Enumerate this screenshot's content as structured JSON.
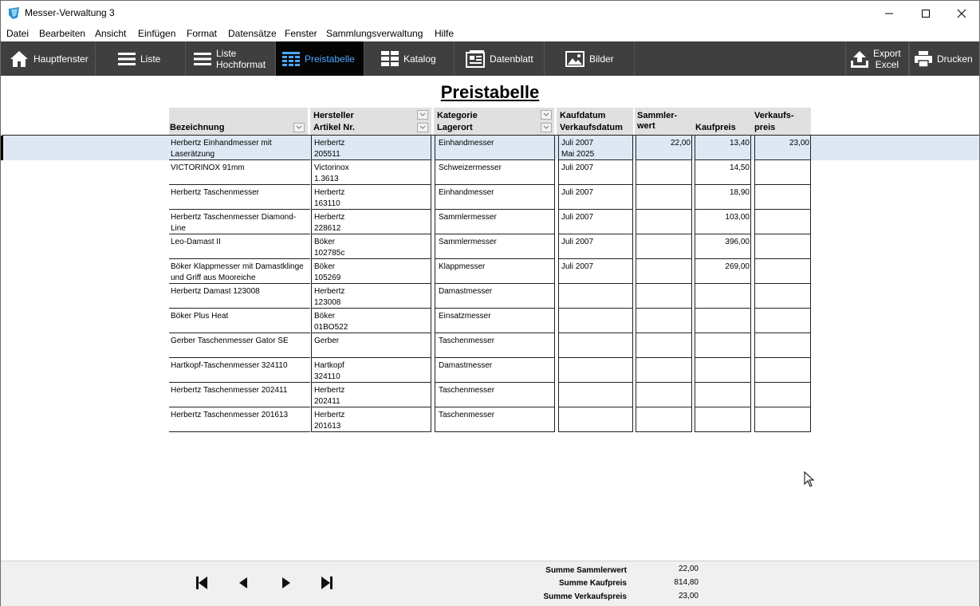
{
  "window": {
    "title": "Messer-Verwaltung 3"
  },
  "menu": [
    "Datei",
    "Bearbeiten",
    "Ansicht",
    "Einfügen",
    "Format",
    "Datensätze",
    "Fenster",
    "Sammlungsverwaltung",
    "Hilfe"
  ],
  "toolbar": {
    "hauptfenster": "Hauptfenster",
    "liste": "Liste",
    "liste_hochformat_1": "Liste",
    "liste_hochformat_2": "Hochformat",
    "preistabelle": "Preistabelle",
    "katalog": "Katalog",
    "datenblatt": "Datenblatt",
    "bilder": "Bilder",
    "export_1": "Export",
    "export_2": "Excel",
    "drucken": "Drucken"
  },
  "page": {
    "title": "Preistabelle"
  },
  "columns": {
    "bezeichnung": "Bezeichnung",
    "hersteller": "Hersteller",
    "artikel": "Artikel Nr.",
    "kategorie": "Kategorie",
    "lagerort": "Lagerort",
    "kaufdatum": "Kaufdatum",
    "verkaufsdatum": "Verkaufsdatum",
    "sammlerwert_1": "Sammler-",
    "sammlerwert_2": "wert",
    "kaufpreis": "Kaufpreis",
    "verkaufspreis_1": "Verkaufs-",
    "verkaufspreis_2": "preis"
  },
  "rows": [
    {
      "bez1": "Herbertz Einhandmesser mit",
      "bez2": "Laserätzung",
      "hersteller": "Herbertz",
      "artikel": "205511",
      "kategorie": "Einhandmesser",
      "lagerort": "",
      "kaufdatum": "Juli 2007",
      "verkaufsdatum": "Mai 2025",
      "sammlerwert": "22,00",
      "kaufpreis": "13,40",
      "verkaufspreis": "23,00",
      "selected": true
    },
    {
      "bez1": "VICTORINOX 91mm",
      "bez2": "",
      "hersteller": "Victorinox",
      "artikel": "1.3613",
      "kategorie": "Schweizermesser",
      "lagerort": "",
      "kaufdatum": "Juli 2007",
      "verkaufsdatum": "",
      "sammlerwert": "",
      "kaufpreis": "14,50",
      "verkaufspreis": ""
    },
    {
      "bez1": "Herbertz Taschenmesser",
      "bez2": "",
      "hersteller": "Herbertz",
      "artikel": "163110",
      "kategorie": "Einhandmesser",
      "lagerort": "",
      "kaufdatum": "Juli 2007",
      "verkaufsdatum": "",
      "sammlerwert": "",
      "kaufpreis": "18,90",
      "verkaufspreis": ""
    },
    {
      "bez1": "Herbertz Taschenmesser Diamond-",
      "bez2": "Line",
      "hersteller": "Herbertz",
      "artikel": "228612",
      "kategorie": "Sammlermesser",
      "lagerort": "",
      "kaufdatum": "Juli 2007",
      "verkaufsdatum": "",
      "sammlerwert": "",
      "kaufpreis": "103,00",
      "verkaufspreis": ""
    },
    {
      "bez1": "Leo-Damast II",
      "bez2": "",
      "hersteller": "Böker",
      "artikel": "102785c",
      "kategorie": "Sammlermesser",
      "lagerort": "",
      "kaufdatum": "Juli 2007",
      "verkaufsdatum": "",
      "sammlerwert": "",
      "kaufpreis": "396,00",
      "verkaufspreis": ""
    },
    {
      "bez1": "Böker Klappmesser mit Damastklinge",
      "bez2": "und Griff aus Mooreiche",
      "hersteller": "Böker",
      "artikel": "105269",
      "kategorie": "Klappmesser",
      "lagerort": "",
      "kaufdatum": "Juli 2007",
      "verkaufsdatum": "",
      "sammlerwert": "",
      "kaufpreis": "269,00",
      "verkaufspreis": ""
    },
    {
      "bez1": "Herbertz Damast  123008",
      "bez2": "",
      "hersteller": "Herbertz",
      "artikel": "123008",
      "kategorie": "Damastmesser",
      "lagerort": "",
      "kaufdatum": "",
      "verkaufsdatum": "",
      "sammlerwert": "",
      "kaufpreis": "",
      "verkaufspreis": ""
    },
    {
      "bez1": "Böker Plus Heat",
      "bez2": "",
      "hersteller": "Böker",
      "artikel": "01BO522",
      "kategorie": "Einsatzmesser",
      "lagerort": "",
      "kaufdatum": "",
      "verkaufsdatum": "",
      "sammlerwert": "",
      "kaufpreis": "",
      "verkaufspreis": ""
    },
    {
      "bez1": "Gerber Taschenmesser Gator SE",
      "bez2": "",
      "hersteller": "Gerber",
      "artikel": "",
      "kategorie": "Taschenmesser",
      "lagerort": "",
      "kaufdatum": "",
      "verkaufsdatum": "",
      "sammlerwert": "",
      "kaufpreis": "",
      "verkaufspreis": ""
    },
    {
      "bez1": "Hartkopf-Taschenmesser 324110",
      "bez2": "",
      "hersteller": "Hartkopf",
      "artikel": "324110",
      "kategorie": "Damastmesser",
      "lagerort": "",
      "kaufdatum": "",
      "verkaufsdatum": "",
      "sammlerwert": "",
      "kaufpreis": "",
      "verkaufspreis": ""
    },
    {
      "bez1": "Herbertz Taschenmesser 202411",
      "bez2": "",
      "hersteller": "Herbertz",
      "artikel": "202411",
      "kategorie": "Taschenmesser",
      "lagerort": "",
      "kaufdatum": "",
      "verkaufsdatum": "",
      "sammlerwert": "",
      "kaufpreis": "",
      "verkaufspreis": ""
    },
    {
      "bez1": "Herbertz Taschenmesser 201613",
      "bez2": "",
      "hersteller": "Herbertz",
      "artikel": "201613",
      "kategorie": "Taschenmesser",
      "lagerort": "",
      "kaufdatum": "",
      "verkaufsdatum": "",
      "sammlerwert": "",
      "kaufpreis": "",
      "verkaufspreis": ""
    }
  ],
  "summary": {
    "sammlerwert_label": "Summe Sammlerwert",
    "sammlerwert_value": "22,00",
    "kaufpreis_label": "Summe Kaufpreis",
    "kaufpreis_value": "814,80",
    "verkaufspreis_label": "Summe Verkaufspreis",
    "verkaufspreis_value": "23,00"
  },
  "colors": {
    "toolbar_bg": "#3f3f3f",
    "active_tab_bg": "#050505",
    "active_tab_text": "#4ca8ff",
    "selected_row": "#dde8f4"
  }
}
